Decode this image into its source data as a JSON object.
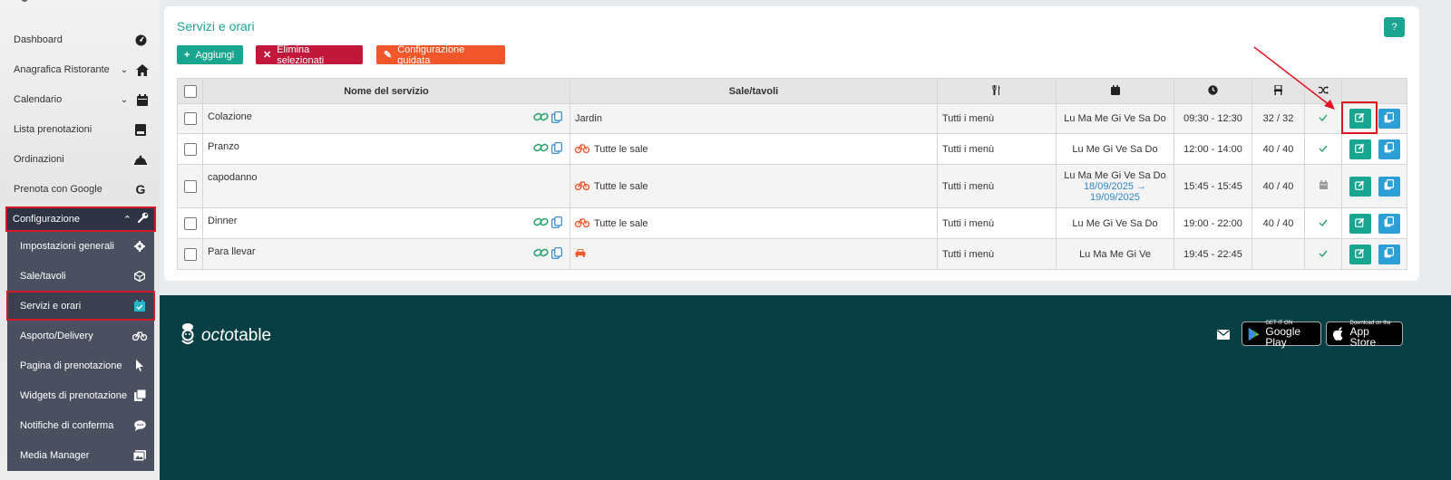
{
  "sidebar": {
    "items": [
      {
        "label": "Dashboard",
        "icon": "dashboard-icon"
      },
      {
        "label": "Anagrafica Ristorante",
        "icon": "home-icon"
      },
      {
        "label": "Calendario",
        "icon": "calendar-icon"
      },
      {
        "label": "Lista prenotazioni",
        "icon": "book-icon"
      },
      {
        "label": "Ordinazioni",
        "icon": "bell-icon"
      },
      {
        "label": "Prenota con Google",
        "icon": "google-icon"
      }
    ],
    "config_label": "Configurazione",
    "sub_items": [
      {
        "label": "Impostazioni generali",
        "icon": "gear-icon"
      },
      {
        "label": "Sale/tavoli",
        "icon": "cube-icon"
      },
      {
        "label": "Servizi e orari",
        "icon": "calendar-check-icon"
      },
      {
        "label": "Asporto/Delivery",
        "icon": "bike-icon"
      },
      {
        "label": "Pagina di prenotazione",
        "icon": "pointer-icon"
      },
      {
        "label": "Widgets di prenotazione",
        "icon": "widgets-icon"
      },
      {
        "label": "Notifiche di conferma",
        "icon": "chat-icon"
      },
      {
        "label": "Media Manager",
        "icon": "images-icon"
      }
    ]
  },
  "main": {
    "title": "Servizi e orari",
    "help_label": "?",
    "buttons": {
      "add": "Aggiungi",
      "delete": "Elimina selezionati",
      "guided": "Configurazione guidata"
    },
    "columns": {
      "name": "Nome del servizio",
      "rooms": "Sale/tavoli"
    },
    "rows": [
      {
        "name": "Colazione",
        "rooms": "Jardin",
        "room_icon": "",
        "menu": "Tutti i menù",
        "days": "Lu Ma Me Gi Ve Sa Do",
        "date_range": "",
        "hours": "09:30 - 12:30",
        "covers": "32 / 32",
        "status": "check"
      },
      {
        "name": "Pranzo",
        "rooms": "Tutte le sale",
        "room_icon": "bike",
        "menu": "Tutti i menù",
        "days": "Lu Me Gi Ve Sa Do",
        "date_range": "",
        "hours": "12:00 - 14:00",
        "covers": "40 / 40",
        "status": "check"
      },
      {
        "name": "capodanno",
        "rooms": "Tutte le sale",
        "room_icon": "bike",
        "menu": "Tutti i menù",
        "days": "Lu Ma Me Gi Ve Sa Do",
        "date_range": "18/09/2025 → 19/09/2025",
        "hours": "15:45 - 15:45",
        "covers": "40 / 40",
        "status": "calendar"
      },
      {
        "name": "Dinner",
        "rooms": "Tutte le sale",
        "room_icon": "bike",
        "menu": "Tutti i menù",
        "days": "Lu Me Gi Ve Sa Do",
        "date_range": "",
        "hours": "19:00 - 22:00",
        "covers": "40 / 40",
        "status": "check"
      },
      {
        "name": "Para llevar",
        "rooms": "",
        "room_icon": "car",
        "menu": "Tutti i menù",
        "days": "Lu Ma Me Gi Ve",
        "date_range": "",
        "hours": "19:45 - 22:45",
        "covers": "",
        "status": "check"
      }
    ]
  },
  "footer": {
    "brand_prefix": "octo",
    "brand_suffix": "table",
    "google_small": "GET IT ON",
    "google_big": "Google Play",
    "apple_small": "Download on the",
    "apple_big": "App Store"
  },
  "colors": {
    "accent": "#1aa591",
    "danger": "#c0173a",
    "warning": "#f2572b",
    "sidebar_dark": "#2e3444",
    "footer": "#083f44"
  }
}
